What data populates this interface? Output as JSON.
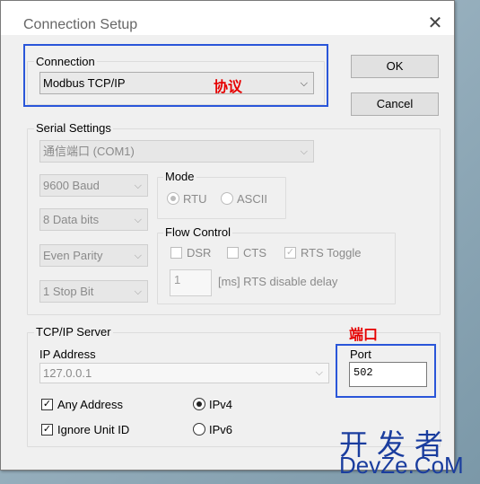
{
  "dialog": {
    "title": "Connection Setup",
    "close_glyph": "✕",
    "ok_label": "OK",
    "cancel_label": "Cancel"
  },
  "connection": {
    "group_label": "Connection",
    "selected": "Modbus TCP/IP"
  },
  "serial": {
    "group_label": "Serial Settings",
    "port": "通信端口 (COM1)",
    "baud": "9600 Baud",
    "data_bits": "8 Data bits",
    "parity": "Even Parity",
    "stop_bits": "1 Stop Bit",
    "mode": {
      "label": "Mode",
      "rtu_label": "RTU",
      "ascii_label": "ASCII",
      "selected": "RTU"
    },
    "flow_control": {
      "label": "Flow Control",
      "dsr_label": "DSR",
      "cts_label": "CTS",
      "rts_toggle_label": "RTS Toggle",
      "rts_toggle_checked": true,
      "rts_delay_value": "1",
      "rts_delay_label": "[ms] RTS disable delay"
    }
  },
  "tcpip": {
    "group_label": "TCP/IP Server",
    "ip_label": "IP Address",
    "ip_value": "127.0.0.1",
    "port_label": "Port",
    "port_value": "502",
    "any_address_label": "Any Address",
    "any_address_checked": true,
    "ignore_unit_id_label": "Ignore Unit ID",
    "ignore_unit_id_checked": true,
    "ipv4_label": "IPv4",
    "ipv6_label": "IPv6",
    "ip_version_selected": "IPv4"
  },
  "annotations": {
    "protocol": "协议",
    "port": "端口"
  },
  "watermark": {
    "line1": "开发者",
    "line2": "DevZe.CoM"
  },
  "colors": {
    "highlight_box": "#2a56d9",
    "annotation_text": "#e60000",
    "watermark": "#1a3d9e"
  },
  "icons": {
    "dropdown": "chevron-down-icon",
    "close": "close-icon",
    "check": "checkmark-icon"
  }
}
